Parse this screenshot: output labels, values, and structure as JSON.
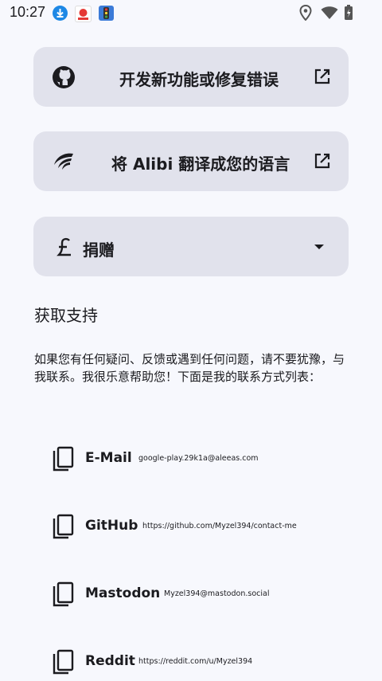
{
  "status_bar": {
    "time": "10:27",
    "notification_icons": [
      "download-icon",
      "red-app-icon",
      "traffic-light-app-icon"
    ],
    "system_icons": [
      "location-icon",
      "wifi-icon",
      "battery-icon"
    ]
  },
  "cards": [
    {
      "icon": "github-icon",
      "label": "开发新功能或修复错误",
      "trailing": "external-link-icon"
    },
    {
      "icon": "translate-bird-icon",
      "label": "将 Alibi 翻译成您的语言",
      "trailing": "external-link-icon"
    },
    {
      "icon": "pound-icon",
      "label": "捐赠",
      "trailing": "dropdown-arrow-icon"
    }
  ],
  "support": {
    "title": "获取支持",
    "description": "如果您有任何疑问、反馈或遇到任何问题，请不要犹豫，与我联系。我很乐意帮助您！下面是我的联系方式列表："
  },
  "contacts": [
    {
      "name": "E-Mail",
      "value": "google-play.29k1a@aleeas.com"
    },
    {
      "name": "GitHub",
      "value": "https://github.com/Myzel394/contact-me"
    },
    {
      "name": "Mastodon",
      "value": "Myzel394@mastodon.social"
    },
    {
      "name": "Reddit",
      "value": "https://reddit.com/u/Myzel394"
    }
  ],
  "colors": {
    "background": "#f7f8fd",
    "card": "#e1e2ec",
    "text": "#1b1b1f"
  }
}
